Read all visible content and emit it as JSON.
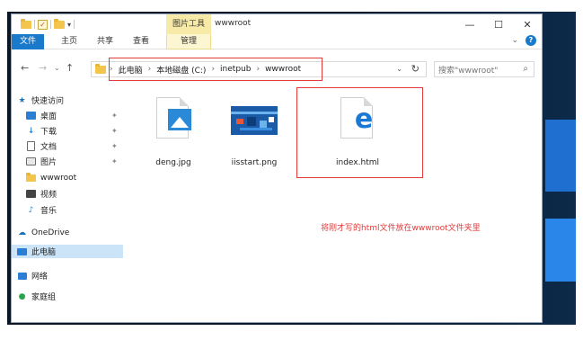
{
  "window": {
    "title": "wwwroot",
    "min_glyph": "—",
    "max_glyph": "☐",
    "close_glyph": "✕"
  },
  "quick_access_toolbar": {
    "dropdown_glyph": "▾",
    "check_glyph": "✓"
  },
  "ribbon": {
    "contextual_group": "图片工具",
    "tabs": {
      "file": "文件",
      "home": "主页",
      "share": "共享",
      "view": "查看",
      "manage": "管理"
    },
    "collapse_glyph": "⌄",
    "help_glyph": "?"
  },
  "address_bar": {
    "back_glyph": "←",
    "forward_glyph": "→",
    "recent_glyph": "⌄",
    "up_glyph": "↑",
    "path": [
      "此电脑",
      "本地磁盘 (C:)",
      "inetpub",
      "wwwroot"
    ],
    "separator": "›",
    "dropdown_glyph": "⌄",
    "refresh_glyph": "↻"
  },
  "search": {
    "placeholder": "搜索\"wwwroot\"",
    "icon_glyph": "⌕"
  },
  "sidebar": {
    "items": [
      {
        "label": "快速访问",
        "icon": "star-icon",
        "color": "#1e73be"
      },
      {
        "label": "桌面",
        "icon": "desktop-icon",
        "color": "#2a7fd4",
        "pinned": true
      },
      {
        "label": "下载",
        "icon": "download-icon",
        "color": "#2a7fd4",
        "pinned": true
      },
      {
        "label": "文档",
        "icon": "document-icon",
        "color": "#6a6a6a",
        "pinned": true
      },
      {
        "label": "图片",
        "icon": "pictures-icon",
        "color": "#6a6a6a",
        "pinned": true
      },
      {
        "label": "wwwroot",
        "icon": "folder-icon",
        "color": "#f3c54b"
      },
      {
        "label": "视频",
        "icon": "video-icon",
        "color": "#444444"
      },
      {
        "label": "音乐",
        "icon": "music-icon",
        "color": "#2a7fd4"
      },
      {
        "label": "OneDrive",
        "icon": "onedrive-icon",
        "color": "#1e73be"
      },
      {
        "label": "此电脑",
        "icon": "this-pc-icon",
        "color": "#2a7fd4",
        "selected": true
      },
      {
        "label": "网络",
        "icon": "network-icon",
        "color": "#2a7fd4"
      },
      {
        "label": "家庭组",
        "icon": "homegroup-icon",
        "color": "#2aa44a"
      }
    ],
    "pin_glyph": "✦"
  },
  "files": [
    {
      "name": "deng.jpg",
      "icon": "image-file-icon"
    },
    {
      "name": "iisstart.png",
      "icon": "png-thumbnail"
    },
    {
      "name": "index.html",
      "icon": "edge-html-icon"
    }
  ],
  "annotation": "将刚才写的html文件放在wwwroot文件夹里",
  "colors": {
    "accent": "#1979ca",
    "highlight": "#e23b3b",
    "selection": "#cce4f7",
    "ribbon_context": "#f7e9a6"
  }
}
